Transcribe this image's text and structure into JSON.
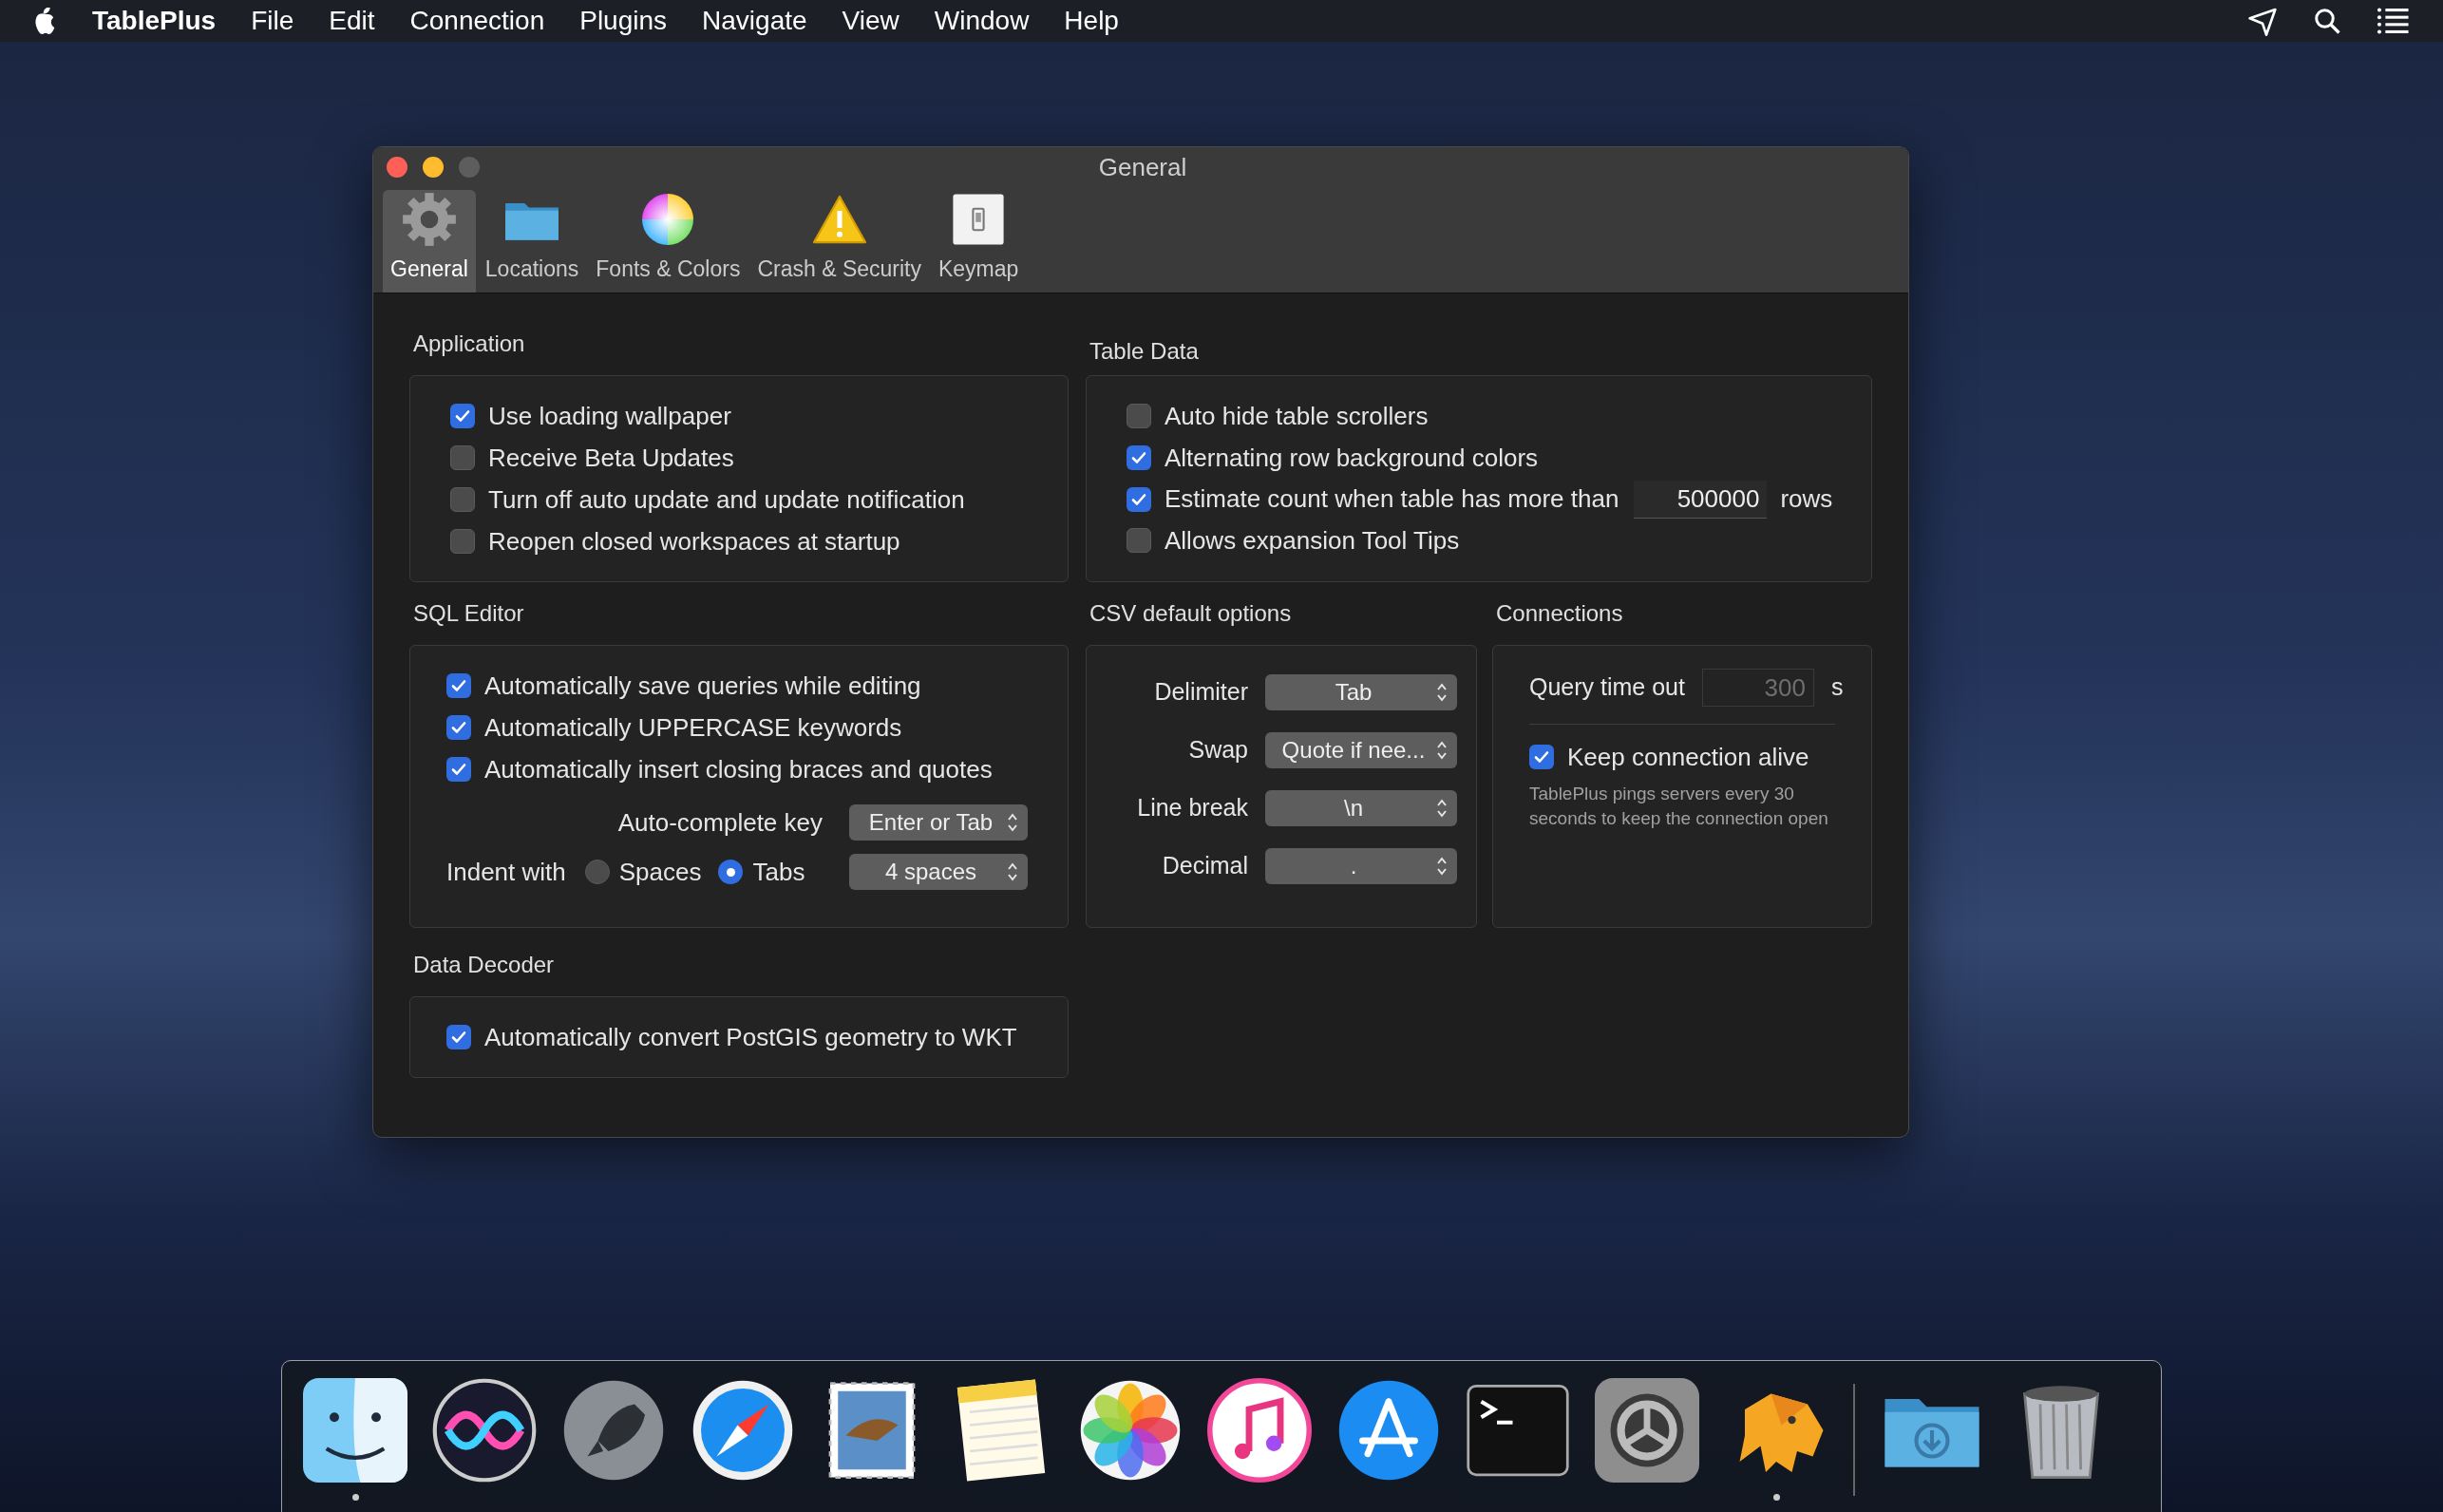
{
  "menu_bar": {
    "app_name": "TablePlus",
    "items": [
      "File",
      "Edit",
      "Connection",
      "Plugins",
      "Navigate",
      "View",
      "Window",
      "Help"
    ]
  },
  "window": {
    "title": "General",
    "toolbar": [
      {
        "label": "General",
        "selected": true
      },
      {
        "label": "Locations",
        "selected": false
      },
      {
        "label": "Fonts & Colors",
        "selected": false
      },
      {
        "label": "Crash & Security",
        "selected": false
      },
      {
        "label": "Keymap",
        "selected": false
      }
    ]
  },
  "application": {
    "title": "Application",
    "options": [
      {
        "label": "Use loading wallpaper",
        "checked": true
      },
      {
        "label": "Receive Beta Updates",
        "checked": false
      },
      {
        "label": "Turn off auto update and update notification",
        "checked": false
      },
      {
        "label": "Reopen closed workspaces at startup",
        "checked": false
      }
    ]
  },
  "table_data": {
    "title": "Table Data",
    "options": [
      {
        "kind": "checkbox",
        "label": "Auto hide table scrollers",
        "checked": false
      },
      {
        "kind": "checkbox",
        "label": "Alternating row background colors",
        "checked": true
      },
      {
        "kind": "with_input",
        "label": "Estimate count when table has more than",
        "checked": true,
        "value": "500000",
        "suffix": "rows"
      },
      {
        "kind": "checkbox",
        "label": "Allows expansion Tool Tips",
        "checked": false
      }
    ]
  },
  "sql_editor": {
    "title": "SQL Editor",
    "options": [
      {
        "label": "Automatically save queries while editing",
        "checked": true
      },
      {
        "label": "Automatically UPPERCASE keywords",
        "checked": true
      },
      {
        "label": "Automatically insert closing braces and quotes",
        "checked": true
      }
    ],
    "autocomplete": {
      "label": "Auto-complete key",
      "value": "Enter or Tab"
    },
    "indent": {
      "label": "Indent with",
      "choices": [
        {
          "label": "Spaces",
          "selected": false
        },
        {
          "label": "Tabs",
          "selected": true
        }
      ],
      "size": "4 spaces"
    }
  },
  "csv": {
    "title": "CSV default options",
    "fields": [
      {
        "label": "Delimiter",
        "value": "Tab"
      },
      {
        "label": "Swap",
        "value": "Quote if nee..."
      },
      {
        "label": "Line break",
        "value": "\\n"
      },
      {
        "label": "Decimal",
        "value": "."
      }
    ]
  },
  "connections": {
    "title": "Connections",
    "timeout": {
      "label": "Query time out",
      "placeholder": "300",
      "unit": "s"
    },
    "keep_alive": {
      "label": "Keep connection alive",
      "checked": true
    },
    "note": "TablePlus pings servers every 30 seconds to keep the connection open"
  },
  "data_decoder": {
    "title": "Data Decoder",
    "options": [
      {
        "label": "Automatically convert PostGIS geometry to WKT",
        "checked": true
      }
    ]
  },
  "dock": [
    {
      "running": true
    },
    {
      "running": false
    },
    {
      "running": false
    },
    {
      "running": false
    },
    {
      "running": false
    },
    {
      "running": false
    },
    {
      "running": false
    },
    {
      "running": false
    },
    {
      "running": false
    },
    {
      "running": false
    },
    {
      "running": false
    },
    {
      "running": true
    },
    {
      "running": false
    },
    {
      "running": false
    }
  ]
}
